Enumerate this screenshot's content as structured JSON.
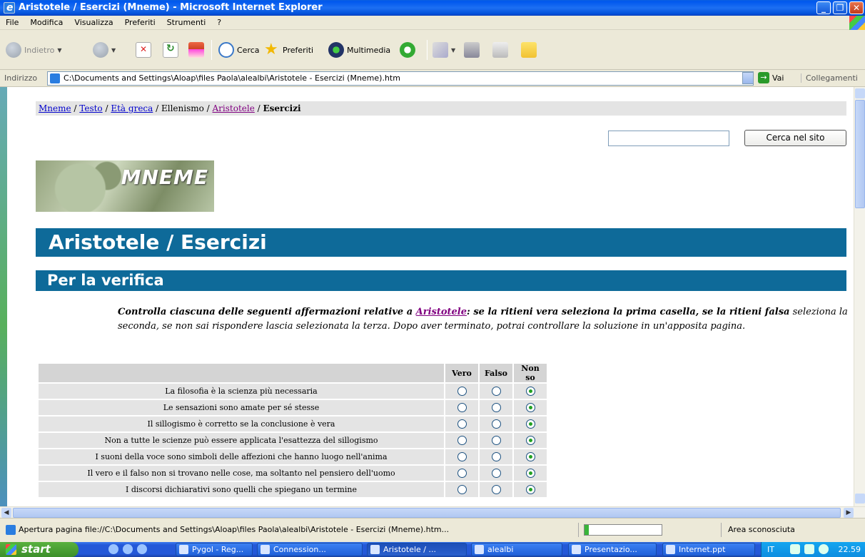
{
  "window": {
    "title": "Aristotele / Esercizi (Mneme) - Microsoft Internet Explorer",
    "controls": [
      "_",
      "❐",
      "✕"
    ]
  },
  "menu": [
    "File",
    "Modifica",
    "Visualizza",
    "Preferiti",
    "Strumenti",
    "?"
  ],
  "toolbar": {
    "back": "Indietro",
    "search": "Cerca",
    "favorites": "Preferiti",
    "media": "Multimedia"
  },
  "address": {
    "label": "Indirizzo",
    "url": "C:\\Documents and Settings\\Aloap\\files Paola\\alealbi\\Aristotele - Esercizi (Mneme).htm",
    "go": "Vai",
    "links": "Collegamenti"
  },
  "page": {
    "breadcrumb": {
      "items": [
        "Mneme",
        "Testo",
        "Età greca",
        "Ellenismo",
        "Aristotele",
        "Esercizi"
      ],
      "sep": " / "
    },
    "search": {
      "value": "",
      "button": "Cerca nel sito"
    },
    "logo_text": "MNEME",
    "title": "Aristotele / Esercizi",
    "section": "Per la verifica",
    "intro": {
      "before": "Controlla ciascuna delle seguenti affermazioni relative a ",
      "link": "Aristotele",
      "bold_after": ": se la ritieni vera seleziona la prima casella, se la ritieni falsa",
      "rest": " seleziona la seconda, se non sai rispondere lascia selezionata la terza. Dopo aver terminato, potrai controllare la soluzione in un'apposita pagina."
    },
    "table": {
      "headers": [
        "",
        "Vero",
        "Falso",
        "Non so"
      ],
      "rows": [
        {
          "text": "La filosofia è la scienza più necessaria",
          "selected": 2
        },
        {
          "text": "Le sensazioni sono amate per sé stesse",
          "selected": 2
        },
        {
          "text": "Il sillogismo è corretto se la conclusione è vera",
          "selected": 2
        },
        {
          "text": "Non a tutte le scienze può essere applicata l'esattezza del sillogismo",
          "selected": 2
        },
        {
          "text": "I suoni della voce sono simboli delle affezioni che hanno luogo nell'anima",
          "selected": 2
        },
        {
          "text": "Il vero e il falso non si trovano nelle cose, ma soltanto nel pensiero dell'uomo",
          "selected": 2
        },
        {
          "text": "I discorsi dichiarativi sono quelli che spiegano un termine",
          "selected": 2
        }
      ]
    }
  },
  "status": {
    "text": "Apertura pagina file://C:\\Documents and Settings\\Aloap\\files Paola\\alealbi\\Aristotele - Esercizi (Mneme).htm...",
    "progress": 0.06,
    "zone": "Area sconosciuta"
  },
  "taskbar": {
    "start": "start",
    "tasks": [
      "Pygol - Reg...",
      "Connession...",
      "Aristotele / ...",
      "alealbi",
      "Presentazio...",
      "Internet.ppt"
    ],
    "active_task": 2,
    "lang": "IT",
    "clock": "22.59"
  },
  "colors": {
    "band": "#0e6a99",
    "radio_selected": "#21a121",
    "link": "#0000cc",
    "visited": "#800080"
  }
}
